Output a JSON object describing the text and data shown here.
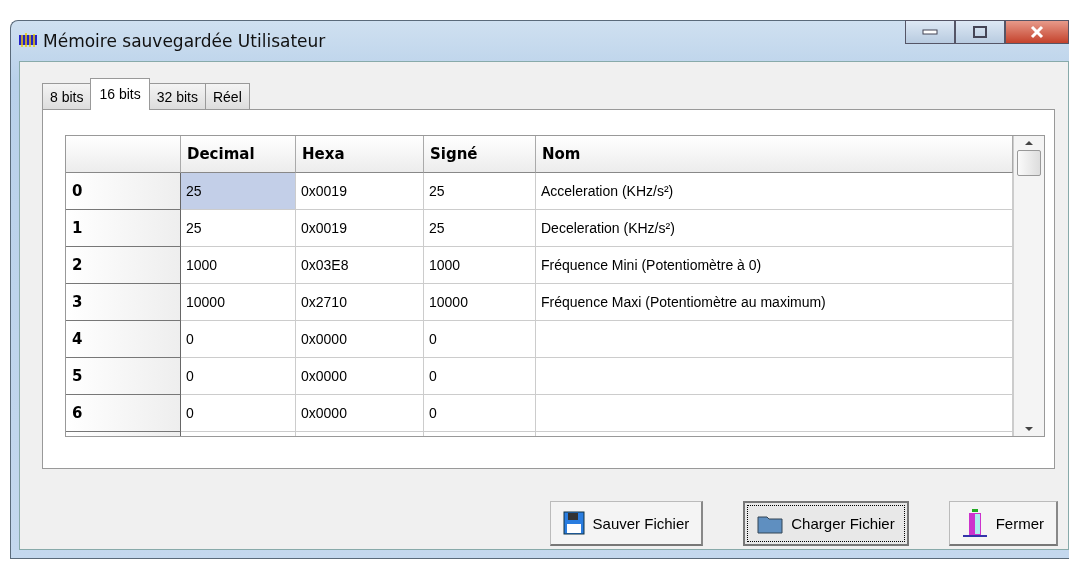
{
  "window": {
    "title": "Mémoire sauvegardée Utilisateur"
  },
  "tabs": [
    {
      "label": "8 bits",
      "selected": false
    },
    {
      "label": "16 bits",
      "selected": true
    },
    {
      "label": "32 bits",
      "selected": false
    },
    {
      "label": "Réel",
      "selected": false
    }
  ],
  "table": {
    "columns": [
      "Decimal",
      "Hexa",
      "Signé",
      "Nom"
    ],
    "rows": [
      {
        "index": "0",
        "cells": [
          {
            "text": "25",
            "selected": true
          },
          {
            "text": "0x0019",
            "selected": false
          },
          {
            "text": "25",
            "selected": false
          },
          {
            "text": "Acceleration  (KHz/s²)",
            "selected": false
          }
        ]
      },
      {
        "index": "1",
        "cells": [
          {
            "text": "25",
            "selected": false
          },
          {
            "text": "0x0019",
            "selected": false
          },
          {
            "text": "25",
            "selected": false
          },
          {
            "text": "Deceleration (KHz/s²)",
            "selected": false
          }
        ]
      },
      {
        "index": "2",
        "cells": [
          {
            "text": "1000",
            "selected": false
          },
          {
            "text": "0x03E8",
            "selected": false
          },
          {
            "text": "1000",
            "selected": false
          },
          {
            "text": "Fréquence Mini (Potentiomètre à 0)",
            "selected": false
          }
        ]
      },
      {
        "index": "3",
        "cells": [
          {
            "text": "10000",
            "selected": false
          },
          {
            "text": "0x2710",
            "selected": false
          },
          {
            "text": "10000",
            "selected": false
          },
          {
            "text": "Fréquence Maxi (Potentiomètre au maximum)",
            "selected": false
          }
        ]
      },
      {
        "index": "4",
        "cells": [
          {
            "text": "0",
            "selected": false
          },
          {
            "text": "0x0000",
            "selected": false
          },
          {
            "text": "0",
            "selected": false
          },
          {
            "selected": false
          }
        ]
      },
      {
        "index": "5",
        "cells": [
          {
            "text": "0",
            "selected": false
          },
          {
            "text": "0x0000",
            "selected": false
          },
          {
            "text": "0",
            "selected": false
          },
          {
            "selected": false
          }
        ]
      },
      {
        "index": "6",
        "cells": [
          {
            "text": "0",
            "selected": false
          },
          {
            "text": "0x0000",
            "selected": false
          },
          {
            "text": "0",
            "selected": false
          },
          {
            "selected": false
          }
        ]
      }
    ]
  },
  "buttons": [
    {
      "kind": "save",
      "label": "Sauver Fichier",
      "focused": false
    },
    {
      "kind": "load",
      "label": "Charger Fichier",
      "focused": true
    },
    {
      "kind": "close",
      "label": "Fermer",
      "focused": false
    }
  ]
}
